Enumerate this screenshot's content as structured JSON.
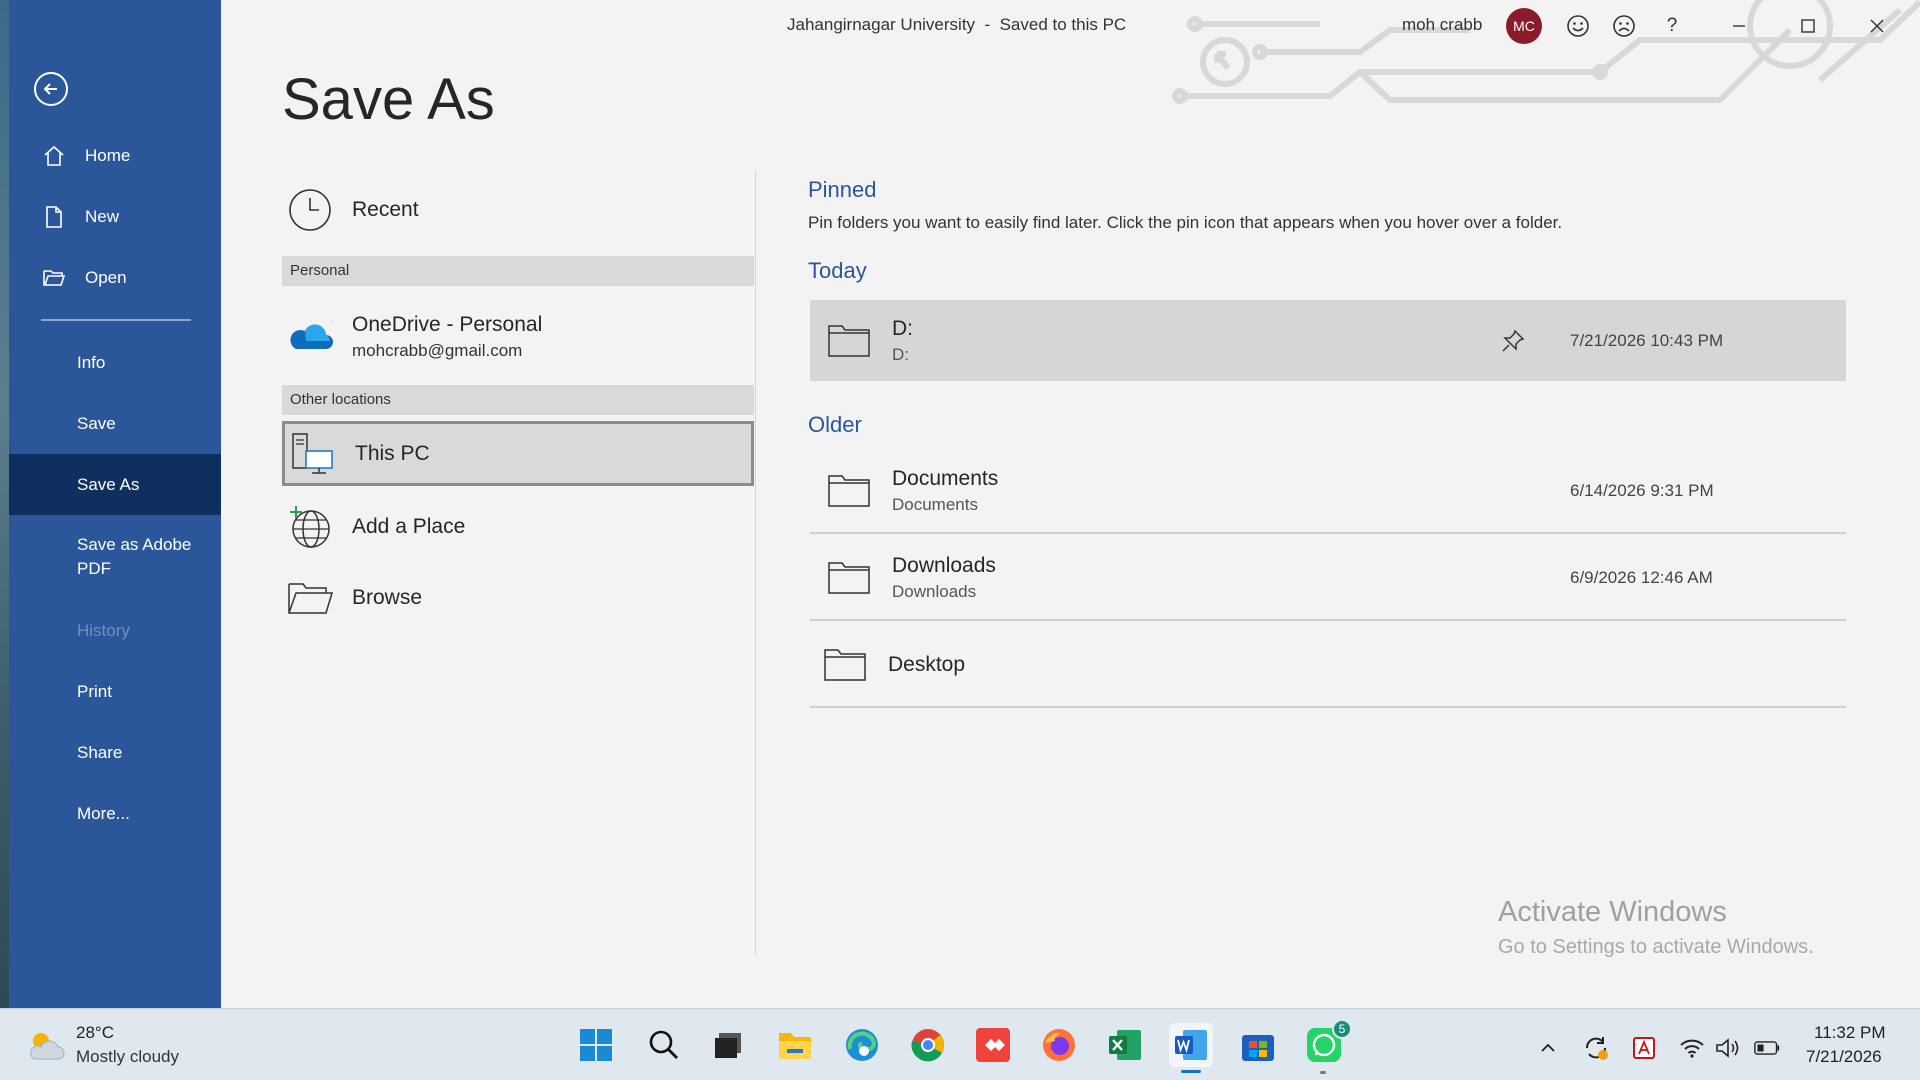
{
  "titlebar": {
    "doc_title": "Jahangirnagar University  -  Saved to this PC",
    "user_name": "moh crabb",
    "avatar_initials": "MC",
    "help": "?"
  },
  "nav": {
    "items": [
      {
        "label": "Home",
        "icon": "home-icon"
      },
      {
        "label": "New",
        "icon": "new-document-icon"
      },
      {
        "label": "Open",
        "icon": "open-folder-icon"
      },
      {
        "label": "Info"
      },
      {
        "label": "Save"
      },
      {
        "label": "Save As",
        "active": true
      },
      {
        "label": "Save as Adobe PDF"
      },
      {
        "label": "History",
        "disabled": true
      },
      {
        "label": "Print"
      },
      {
        "label": "Share"
      },
      {
        "label": "More..."
      }
    ]
  },
  "page_title": "Save As",
  "locations": {
    "recent": "Recent",
    "section_personal": "Personal",
    "onedrive_name": "OneDrive - Personal",
    "onedrive_email": "mohcrabb@gmail.com",
    "section_other": "Other locations",
    "this_pc": "This PC",
    "add_place": "Add a Place",
    "browse": "Browse"
  },
  "right": {
    "pinned_heading": "Pinned",
    "pinned_desc": "Pin folders you want to easily find later. Click the pin icon that appears when you hover over a folder.",
    "today_heading": "Today",
    "today": [
      {
        "name": "D:",
        "path": "D:",
        "date": "7/21/2026 10:43 PM"
      }
    ],
    "older_heading": "Older",
    "older": [
      {
        "name": "Documents",
        "path": "Documents",
        "date": "6/14/2026 9:31 PM"
      },
      {
        "name": "Downloads",
        "path": "Downloads",
        "date": "6/9/2026 12:46 AM"
      },
      {
        "name": "Desktop",
        "path": "",
        "date": ""
      }
    ]
  },
  "watermark": {
    "line1": "Activate Windows",
    "line2": "Go to Settings to activate Windows."
  },
  "taskbar": {
    "weather_temp": "28°C",
    "weather_desc": "Mostly cloudy",
    "whatsapp_badge": "5",
    "time": "11:32 PM",
    "date": "7/21/2026"
  },
  "colors": {
    "nav_bg": "#2b579a",
    "nav_active": "#0f2f5f",
    "heading_blue": "#2b579a",
    "avatar": "#8b1a2b"
  }
}
